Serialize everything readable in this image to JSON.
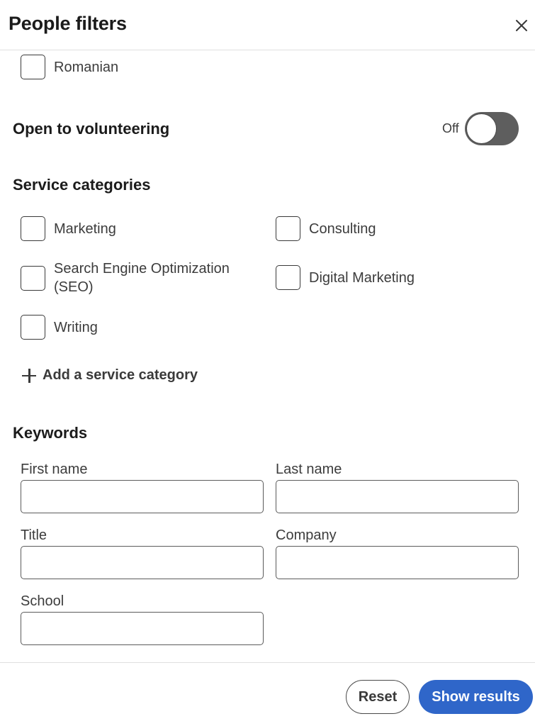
{
  "header": {
    "title": "People filters",
    "close_icon": "close-icon"
  },
  "languages": {
    "items": [
      {
        "label": "Romanian",
        "checked": false
      }
    ]
  },
  "volunteering": {
    "heading": "Open to volunteering",
    "toggle_state": "Off",
    "toggle_on": false
  },
  "service_categories": {
    "heading": "Service categories",
    "items": [
      {
        "label": "Marketing",
        "checked": false
      },
      {
        "label": "Consulting",
        "checked": false
      },
      {
        "label": "Search Engine Optimization (SEO)",
        "checked": false
      },
      {
        "label": "Digital Marketing",
        "checked": false
      },
      {
        "label": "Writing",
        "checked": false
      }
    ],
    "add_label": "Add a service category"
  },
  "keywords": {
    "heading": "Keywords",
    "fields": {
      "first_name": {
        "label": "First name",
        "value": ""
      },
      "last_name": {
        "label": "Last name",
        "value": ""
      },
      "title": {
        "label": "Title",
        "value": ""
      },
      "company": {
        "label": "Company",
        "value": ""
      },
      "school": {
        "label": "School",
        "value": ""
      }
    }
  },
  "footer": {
    "reset_label": "Reset",
    "show_results_label": "Show results"
  },
  "colors": {
    "primary": "#2f66c9",
    "toggle_off": "#5e5e5e",
    "text": "#1b1b1b"
  }
}
